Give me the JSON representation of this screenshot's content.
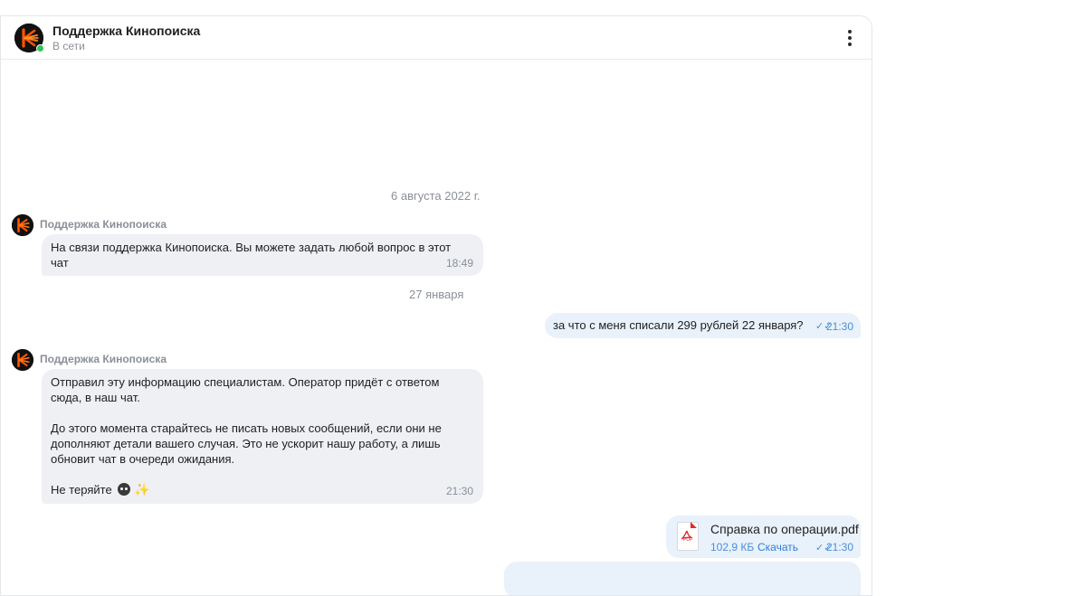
{
  "header": {
    "title": "Поддержка Кинопоиска",
    "status": "В сети"
  },
  "messages": {
    "date1": "6 августа 2022 г.",
    "m1": {
      "sender": "Поддержка Кинопоиска",
      "text": "На связи поддержка Кинопоиска. Вы можете задать любой вопрос в этот чат",
      "time": "18:49"
    },
    "date2": "27 января",
    "m2": {
      "text": "за что с меня списали 299 рублей 22 января?",
      "time": "21:30"
    },
    "m3": {
      "sender": "Поддержка Кинопоиска",
      "p1": "Отправил эту информацию специалистам. Оператор придёт с ответом сюда, в наш чат.",
      "p2": "До этого момента старайтесь не писать новых сообщений, если они не дополняют детали вашего случая. Это не ускорит нашу работу, а лишь обновит чат в очереди ожидания.",
      "p3": "Не теряйте",
      "time": "21:30"
    },
    "m4": {
      "file_name": "Справка по операции.pdf",
      "file_size": "102,9 КБ",
      "download_label": "Скачать",
      "time": "21:30",
      "file_badge": "PDF"
    }
  },
  "colors": {
    "brand": "#ff5500",
    "online": "#2ec45a",
    "incoming_bubble": "#eef0f4",
    "outgoing_bubble": "#e9f1fb",
    "accent": "#4a8fd8"
  },
  "icons": {
    "avatar": "kinopoisk-logo-icon",
    "menu": "more-vertical-icon",
    "read": "double-check-icon",
    "file": "pdf-file-icon",
    "emoji": "cat-face-icon, sparkles-icon"
  }
}
